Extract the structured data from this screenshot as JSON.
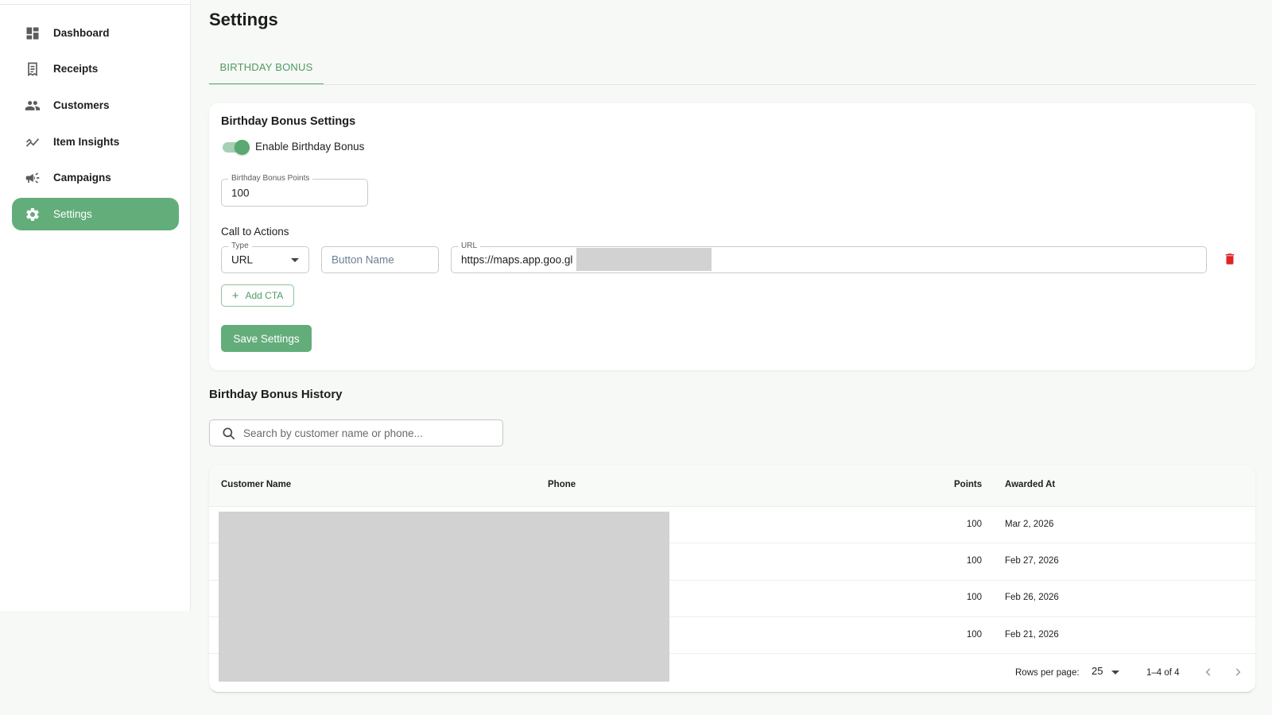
{
  "sidebar": {
    "items": [
      {
        "label": "Dashboard",
        "icon": "dashboard-icon"
      },
      {
        "label": "Receipts",
        "icon": "receipt-icon"
      },
      {
        "label": "Customers",
        "icon": "people-icon"
      },
      {
        "label": "Item Insights",
        "icon": "trend-icon"
      },
      {
        "label": "Campaigns",
        "icon": "megaphone-icon"
      },
      {
        "label": "Settings",
        "icon": "gear-icon",
        "active": true
      }
    ]
  },
  "header": {
    "title": "Settings"
  },
  "tabs": [
    {
      "label": "BIRTHDAY BONUS",
      "active": true
    }
  ],
  "bonus_settings": {
    "title": "Birthday Bonus Settings",
    "enable_label": "Enable Birthday Bonus",
    "enabled": true,
    "points_label": "Birthday Bonus Points",
    "points_value": "100",
    "cta_title": "Call to Actions",
    "cta": {
      "type_label": "Type",
      "type_value": "URL",
      "button_name_placeholder": "Button Name",
      "url_label": "URL",
      "url_value": "https://maps.app.goo.gl"
    },
    "add_cta_label": "Add CTA",
    "save_label": "Save Settings"
  },
  "history": {
    "title": "Birthday Bonus History",
    "search_placeholder": "Search by customer name or phone...",
    "columns": [
      "Customer Name",
      "Phone",
      "Points",
      "Awarded At"
    ],
    "rows": [
      {
        "points": "100",
        "awarded_at": "Mar 2, 2026"
      },
      {
        "points": "100",
        "awarded_at": "Feb 27, 2026"
      },
      {
        "points": "100",
        "awarded_at": "Feb 26, 2026"
      },
      {
        "points": "100",
        "awarded_at": "Feb 21, 2026"
      }
    ],
    "pagination": {
      "rows_per_page_label": "Rows per page:",
      "rows_per_page_value": "25",
      "range": "1–4 of 4"
    }
  },
  "colors": {
    "accent": "#63ad7b",
    "accent_text": "#4f9a66",
    "danger": "#e02424"
  }
}
